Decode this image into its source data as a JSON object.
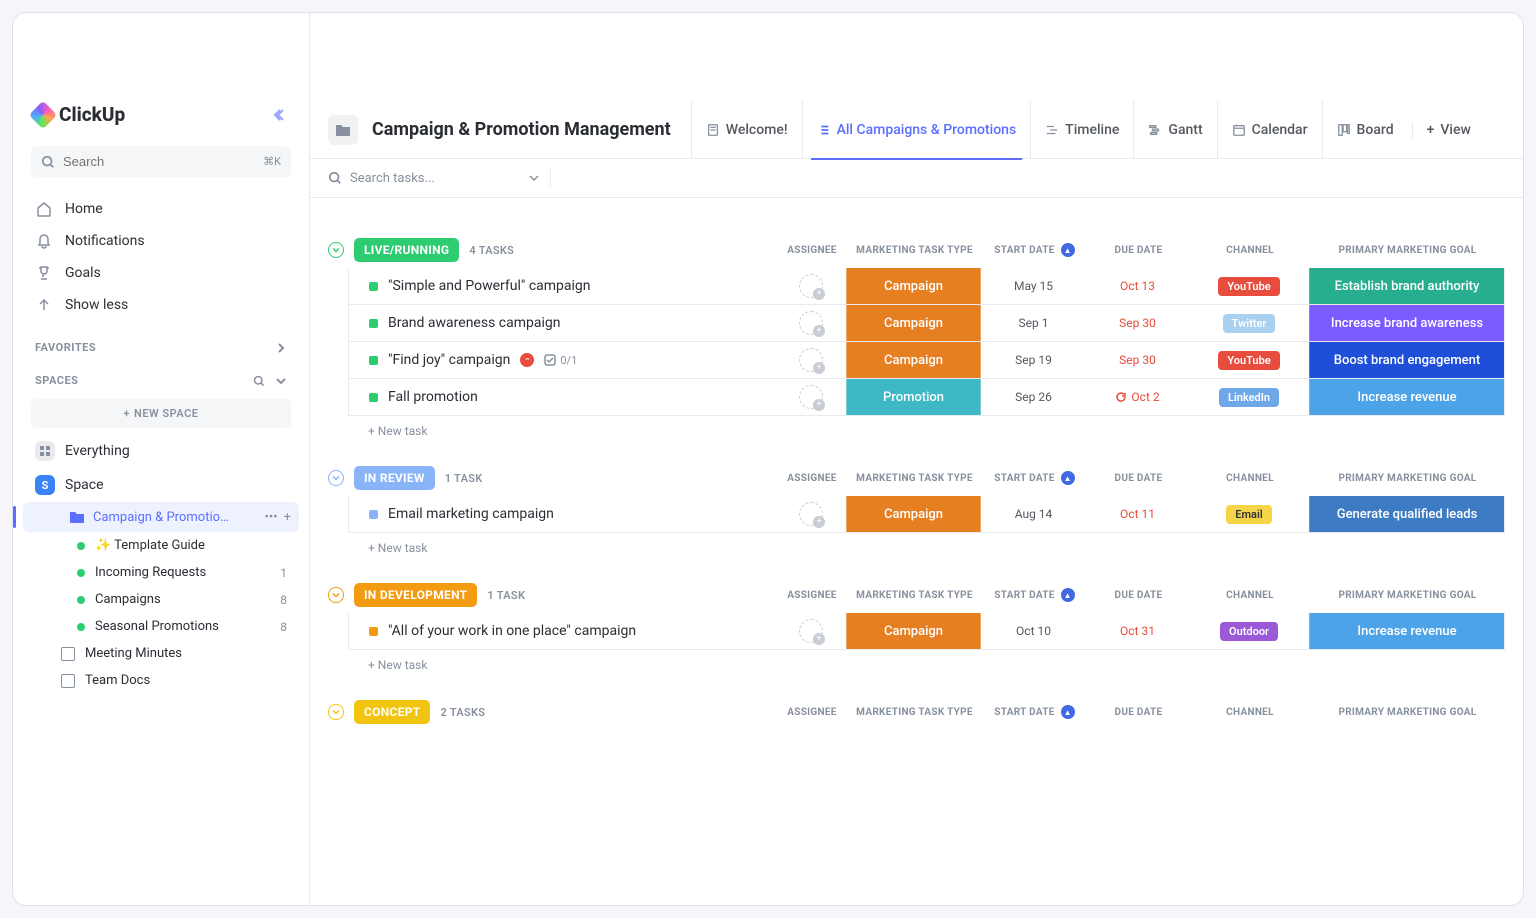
{
  "brand": "ClickUp",
  "sidebar": {
    "search_placeholder": "Search",
    "search_shortcut": "⌘K",
    "nav": [
      {
        "label": "Home",
        "icon": "home"
      },
      {
        "label": "Notifications",
        "icon": "bell"
      },
      {
        "label": "Goals",
        "icon": "trophy"
      },
      {
        "label": "Show less",
        "icon": "arrow-up"
      }
    ],
    "favorites_label": "FAVORITES",
    "spaces_label": "SPACES",
    "new_space_label": "NEW SPACE",
    "everything_label": "Everything",
    "space_name": "Space",
    "folder": {
      "label": "Campaign & Promotion M…"
    },
    "lists": [
      {
        "label": "✨ Template Guide",
        "dot": "#2ecc71",
        "count": ""
      },
      {
        "label": "Incoming Requests",
        "dot": "#2ecc71",
        "count": "1"
      },
      {
        "label": "Campaigns",
        "dot": "#2ecc71",
        "count": "8"
      },
      {
        "label": "Seasonal Promotions",
        "dot": "#2ecc71",
        "count": "8"
      }
    ],
    "docs": [
      {
        "label": "Meeting Minutes"
      },
      {
        "label": "Team Docs"
      }
    ]
  },
  "header": {
    "title": "Campaign & Promotion Management",
    "tabs": [
      {
        "label": "Welcome!",
        "icon": "doc"
      },
      {
        "label": "All Campaigns & Promotions",
        "icon": "list",
        "active": true
      },
      {
        "label": "Timeline",
        "icon": "timeline"
      },
      {
        "label": "Gantt",
        "icon": "gantt"
      },
      {
        "label": "Calendar",
        "icon": "calendar"
      },
      {
        "label": "Board",
        "icon": "board"
      }
    ],
    "add_view": "View"
  },
  "filter": {
    "search_placeholder": "Search tasks..."
  },
  "columns": [
    "ASSIGNEE",
    "MARKETING TASK TYPE",
    "START DATE",
    "DUE DATE",
    "CHANNEL",
    "PRIMARY MARKETING GOAL"
  ],
  "groups": [
    {
      "status": "LIVE/RUNNING",
      "status_color": "#2ecc71",
      "count": "4 TASKS",
      "tasks": [
        {
          "sq": "#2ecc71",
          "name": "\"Simple and Powerful\" campaign",
          "type": "Campaign",
          "type_bg": "#e67e22",
          "start": "May 15",
          "due": "Oct 13",
          "due_red": true,
          "channel": "YouTube",
          "channel_bg": "#e74c3c",
          "goal": "Establish brand authority",
          "goal_bg": "#27ae8f"
        },
        {
          "sq": "#2ecc71",
          "name": "Brand awareness campaign",
          "type": "Campaign",
          "type_bg": "#e67e22",
          "start": "Sep 1",
          "due": "Sep 30",
          "due_red": true,
          "channel": "Twitter",
          "channel_bg": "#a8d0f0",
          "goal": "Increase brand awareness",
          "goal_bg": "#7b5bff"
        },
        {
          "sq": "#2ecc71",
          "name": "\"Find joy\" campaign",
          "blocked": true,
          "sub": "0/1",
          "type": "Campaign",
          "type_bg": "#e67e22",
          "start": "Sep 19",
          "due": "Sep 30",
          "due_red": true,
          "channel": "YouTube",
          "channel_bg": "#e74c3c",
          "goal": "Boost brand engagement",
          "goal_bg": "#1f4fd8"
        },
        {
          "sq": "#2ecc71",
          "name": "Fall promotion",
          "type": "Promotion",
          "type_bg": "#3db8c4",
          "start": "Sep 26",
          "due": "Oct 2",
          "due_red": true,
          "recur": true,
          "channel": "LinkedIn",
          "channel_bg": "#6fa8e8",
          "goal": "Increase revenue",
          "goal_bg": "#4da3e8"
        }
      ]
    },
    {
      "status": "IN REVIEW",
      "status_color": "#8ab4f8",
      "count": "1 TASK",
      "tasks": [
        {
          "sq": "#8ab4f8",
          "name": "Email marketing campaign",
          "type": "Campaign",
          "type_bg": "#e67e22",
          "start": "Aug 14",
          "due": "Oct 11",
          "due_red": true,
          "channel": "Email",
          "channel_bg": "#f5d547",
          "channel_fg": "#333",
          "goal": "Generate qualified leads",
          "goal_bg": "#3d7bc4"
        }
      ]
    },
    {
      "status": "IN DEVELOPMENT",
      "status_color": "#f39c12",
      "count": "1 TASK",
      "tasks": [
        {
          "sq": "#f39c12",
          "name": "\"All of your work in one place\" campaign",
          "type": "Campaign",
          "type_bg": "#e67e22",
          "start": "Oct 10",
          "due": "Oct 31",
          "due_red": true,
          "channel": "Outdoor",
          "channel_bg": "#9b59d8",
          "goal": "Increase revenue",
          "goal_bg": "#4da3e8"
        }
      ]
    },
    {
      "status": "CONCEPT",
      "status_color": "#f1c40f",
      "count": "2 TASKS",
      "tasks": []
    }
  ],
  "new_task_label": "+ New task"
}
